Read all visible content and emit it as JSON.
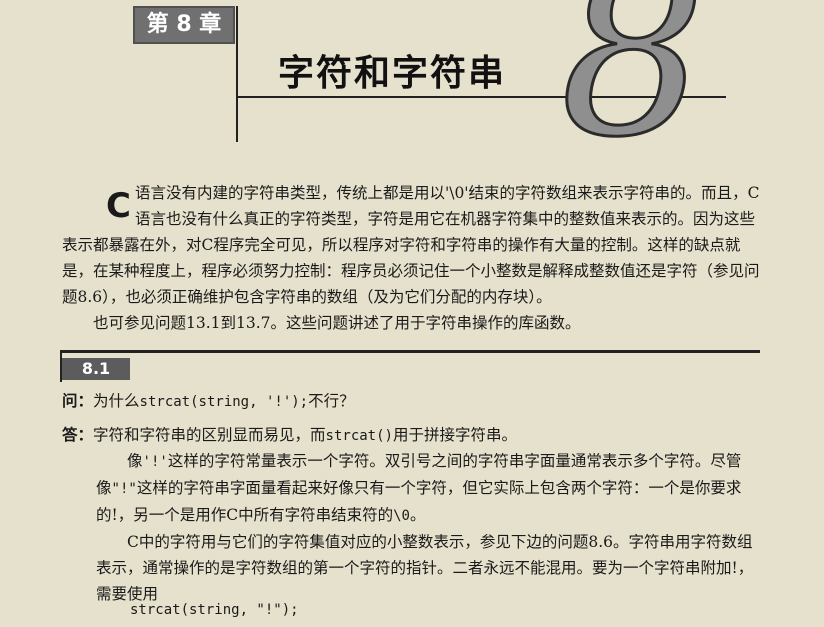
{
  "chapter": {
    "badge": "第 8 章",
    "title": "字符和字符串",
    "number": "8"
  },
  "intro": {
    "dropcap": "C",
    "line1": "语言没有内建的字符串类型，传统上都是用以'\\0'结束的字符数组来表示字符串的。",
    "rest": "而且，C语言也没有什么真正的字符类型，字符是用它在机器字符集中的整数值来表示的。因为这些表示都暴露在外，对C程序完全可见，所以程序对字符和字符串的操作有大量的控制。这样的缺点就是，在某种程度上，程序必须努力控制：程序员必须记住一个小整数是解释成整数值还是字符（参见问题8.6），也必须正确维护包含字符串的数组（及为它们分配的内存块）。",
    "see_also": "也可参见问题13.1到13.7。这些问题讲述了用于字符串操作的库函数。"
  },
  "section": {
    "number": "8.1",
    "question_label": "问：",
    "question_text_pre": "为什么",
    "question_code": "strcat(string, '!');",
    "question_text_post": "不行？",
    "answer_label": "答：",
    "answer_pre": "字符和字符串的区别显而易见，而",
    "answer_code": "strcat()",
    "answer_post": "用于拼接字符串。",
    "para1_a": "像",
    "para1_code1": "'!'",
    "para1_b": "这样的字符常量表示一个字符。双引号之间的字符串字面量通常表示多个字符。尽管像",
    "para1_code2": "\"!\"",
    "para1_c": "这样的字符串字面量看起来好像只有一个字符，但它实际上包含两个字符：一个是你要求的!，另一个是用作C中所有字符串结束符的",
    "para1_code3": "\\0",
    "para1_d": "。",
    "para2": "C中的字符用与它们的字符集值对应的小整数表示，参见下边的问题8.6。字符串用字符数组表示，通常操作的是字符数组的第一个字符的指针。二者永远不能混用。要为一个字符串附加!，需要使用",
    "code_line": "strcat(string, \"!\");"
  }
}
